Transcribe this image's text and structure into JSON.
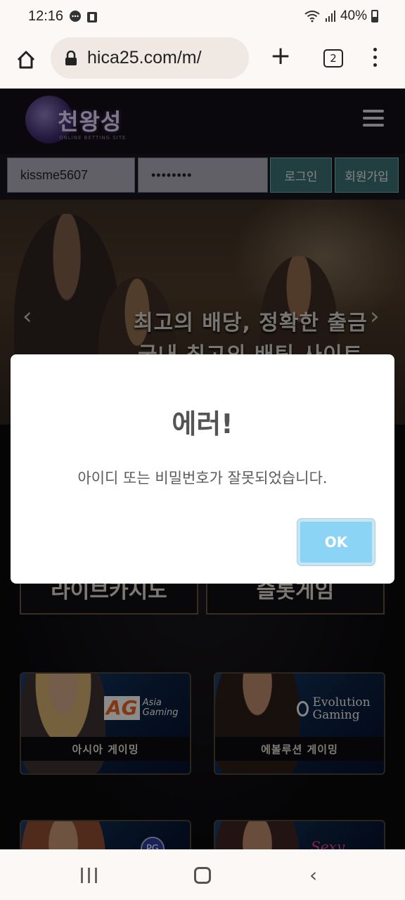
{
  "status_bar": {
    "time": "12:16",
    "battery": "40%"
  },
  "browser": {
    "url": "hica25.com/m/",
    "tab_count": "2"
  },
  "site": {
    "logo_title": "천왕성",
    "logo_subtitle": "ONLINE BETTING SITE"
  },
  "login": {
    "username_value": "kissme5607",
    "password_value": "••••••••",
    "login_label": "로그인",
    "signup_label": "회원가입"
  },
  "banner": {
    "line1": "최고의 배당, 정확한 출금",
    "line2": "국내 최고의 배팅 사이트"
  },
  "categories": {
    "live_casino": "라이브카지노",
    "slot_game": "슬롯게임"
  },
  "games": [
    {
      "label": "아시아 게이밍",
      "brand": "AG",
      "brand_sub": "Asia Gaming"
    },
    {
      "label": "에볼루션 게이밍",
      "brand": "Evolution Gaming"
    },
    {
      "brand": "PG"
    },
    {
      "brand": "Sexy"
    }
  ],
  "modal": {
    "title": "에러!",
    "message": "아이디 또는 비밀번호가 잘못되었습니다.",
    "ok_label": "OK"
  }
}
